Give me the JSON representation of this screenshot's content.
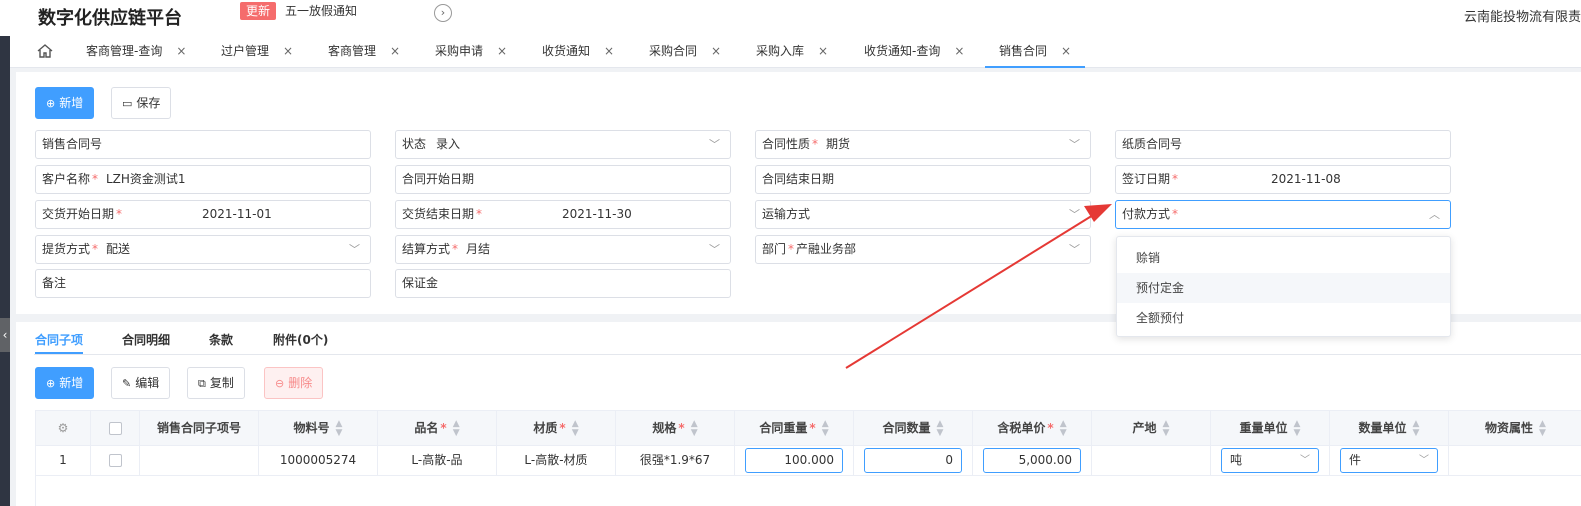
{
  "header": {
    "brand": "数字化供应链平台",
    "update_badge": "更新",
    "notice": "五一放假通知",
    "company": "云南能投物流有限责"
  },
  "tabs": [
    {
      "label": "客商管理-查询",
      "close": "×"
    },
    {
      "label": "过户管理",
      "close": "×"
    },
    {
      "label": "客商管理",
      "close": "×"
    },
    {
      "label": "采购申请",
      "close": "×"
    },
    {
      "label": "收货通知",
      "close": "×"
    },
    {
      "label": "采购合同",
      "close": "×"
    },
    {
      "label": "采购入库",
      "close": "×"
    },
    {
      "label": "收货通知-查询",
      "close": "×"
    },
    {
      "label": "销售合同",
      "close": "×"
    }
  ],
  "toolbar": {
    "add_label": "新增",
    "save_label": "保存"
  },
  "form": {
    "sales_contract_no": {
      "label": "销售合同号",
      "value": ""
    },
    "status": {
      "label": "状态",
      "value": "录入"
    },
    "contract_nature": {
      "label": "合同性质",
      "required": "*",
      "value": "期货"
    },
    "paper_contract_no": {
      "label": "纸质合同号",
      "value": ""
    },
    "customer_name": {
      "label": "客户名称",
      "required": "*",
      "value": "LZH资金测试1"
    },
    "contract_start": {
      "label": "合同开始日期",
      "value": ""
    },
    "contract_end": {
      "label": "合同结束日期",
      "value": ""
    },
    "sign_date": {
      "label": "签订日期",
      "required": "*",
      "value": "2021-11-08"
    },
    "delivery_start": {
      "label": "交货开始日期",
      "required": "*",
      "value": "2021-11-01"
    },
    "delivery_end": {
      "label": "交货结束日期",
      "required": "*",
      "value": "2021-11-30"
    },
    "transport": {
      "label": "运输方式",
      "value": ""
    },
    "payment": {
      "label": "付款方式",
      "required": "*",
      "value": ""
    },
    "pickup": {
      "label": "提货方式",
      "required": "*",
      "value": "配送"
    },
    "settlement": {
      "label": "结算方式",
      "required": "*",
      "value": "月结"
    },
    "department": {
      "label": "部门",
      "required": "*",
      "value": "产融业务部"
    },
    "remark": {
      "label": "备注",
      "value": ""
    },
    "deposit": {
      "label": "保证金",
      "value": ""
    }
  },
  "payment_dropdown": {
    "options": [
      "赊销",
      "预付定金",
      "全额预付"
    ],
    "hovered_index": 1
  },
  "subtabs": [
    "合同子项",
    "合同明细",
    "条款",
    "附件(0个)"
  ],
  "sub_toolbar": {
    "add_label": "新增",
    "edit_label": "编辑",
    "copy_label": "复制",
    "delete_label": "删除"
  },
  "table": {
    "columns": [
      {
        "label": "",
        "required": ""
      },
      {
        "label": "",
        "required": ""
      },
      {
        "label": "销售合同子项号",
        "required": ""
      },
      {
        "label": "物料号",
        "required": ""
      },
      {
        "label": "品名",
        "required": "*"
      },
      {
        "label": "材质",
        "required": "*"
      },
      {
        "label": "规格",
        "required": "*"
      },
      {
        "label": "合同重量",
        "required": "*"
      },
      {
        "label": "合同数量",
        "required": ""
      },
      {
        "label": "含税单价",
        "required": "*"
      },
      {
        "label": "产地",
        "required": ""
      },
      {
        "label": "重量单位",
        "required": ""
      },
      {
        "label": "数量单位",
        "required": ""
      },
      {
        "label": "物资属性",
        "required": ""
      }
    ],
    "rows": [
      {
        "index": "1",
        "sub_item_no": "",
        "material_no": "1000005274",
        "product_name": "L-高散-品",
        "material": "L-高散-材质",
        "spec": "很强*1.9*67",
        "contract_weight": "100.000",
        "contract_qty": "0",
        "unit_price": "5,000.00",
        "origin": "",
        "weight_unit": "吨",
        "qty_unit": "件",
        "material_attr": ""
      }
    ]
  },
  "colors": {
    "primary": "#409eff",
    "danger": "#f56c6c",
    "badge": "#f56c6c",
    "arrow": "#e53935"
  },
  "icons": {
    "home": "home-icon",
    "notice_arrow": "chevron-right-circle-icon",
    "add": "plus-circle-icon",
    "save": "folder-icon",
    "edit": "pencil-icon",
    "copy": "copy-icon",
    "delete": "minus-circle-icon",
    "settings": "gear-icon"
  }
}
